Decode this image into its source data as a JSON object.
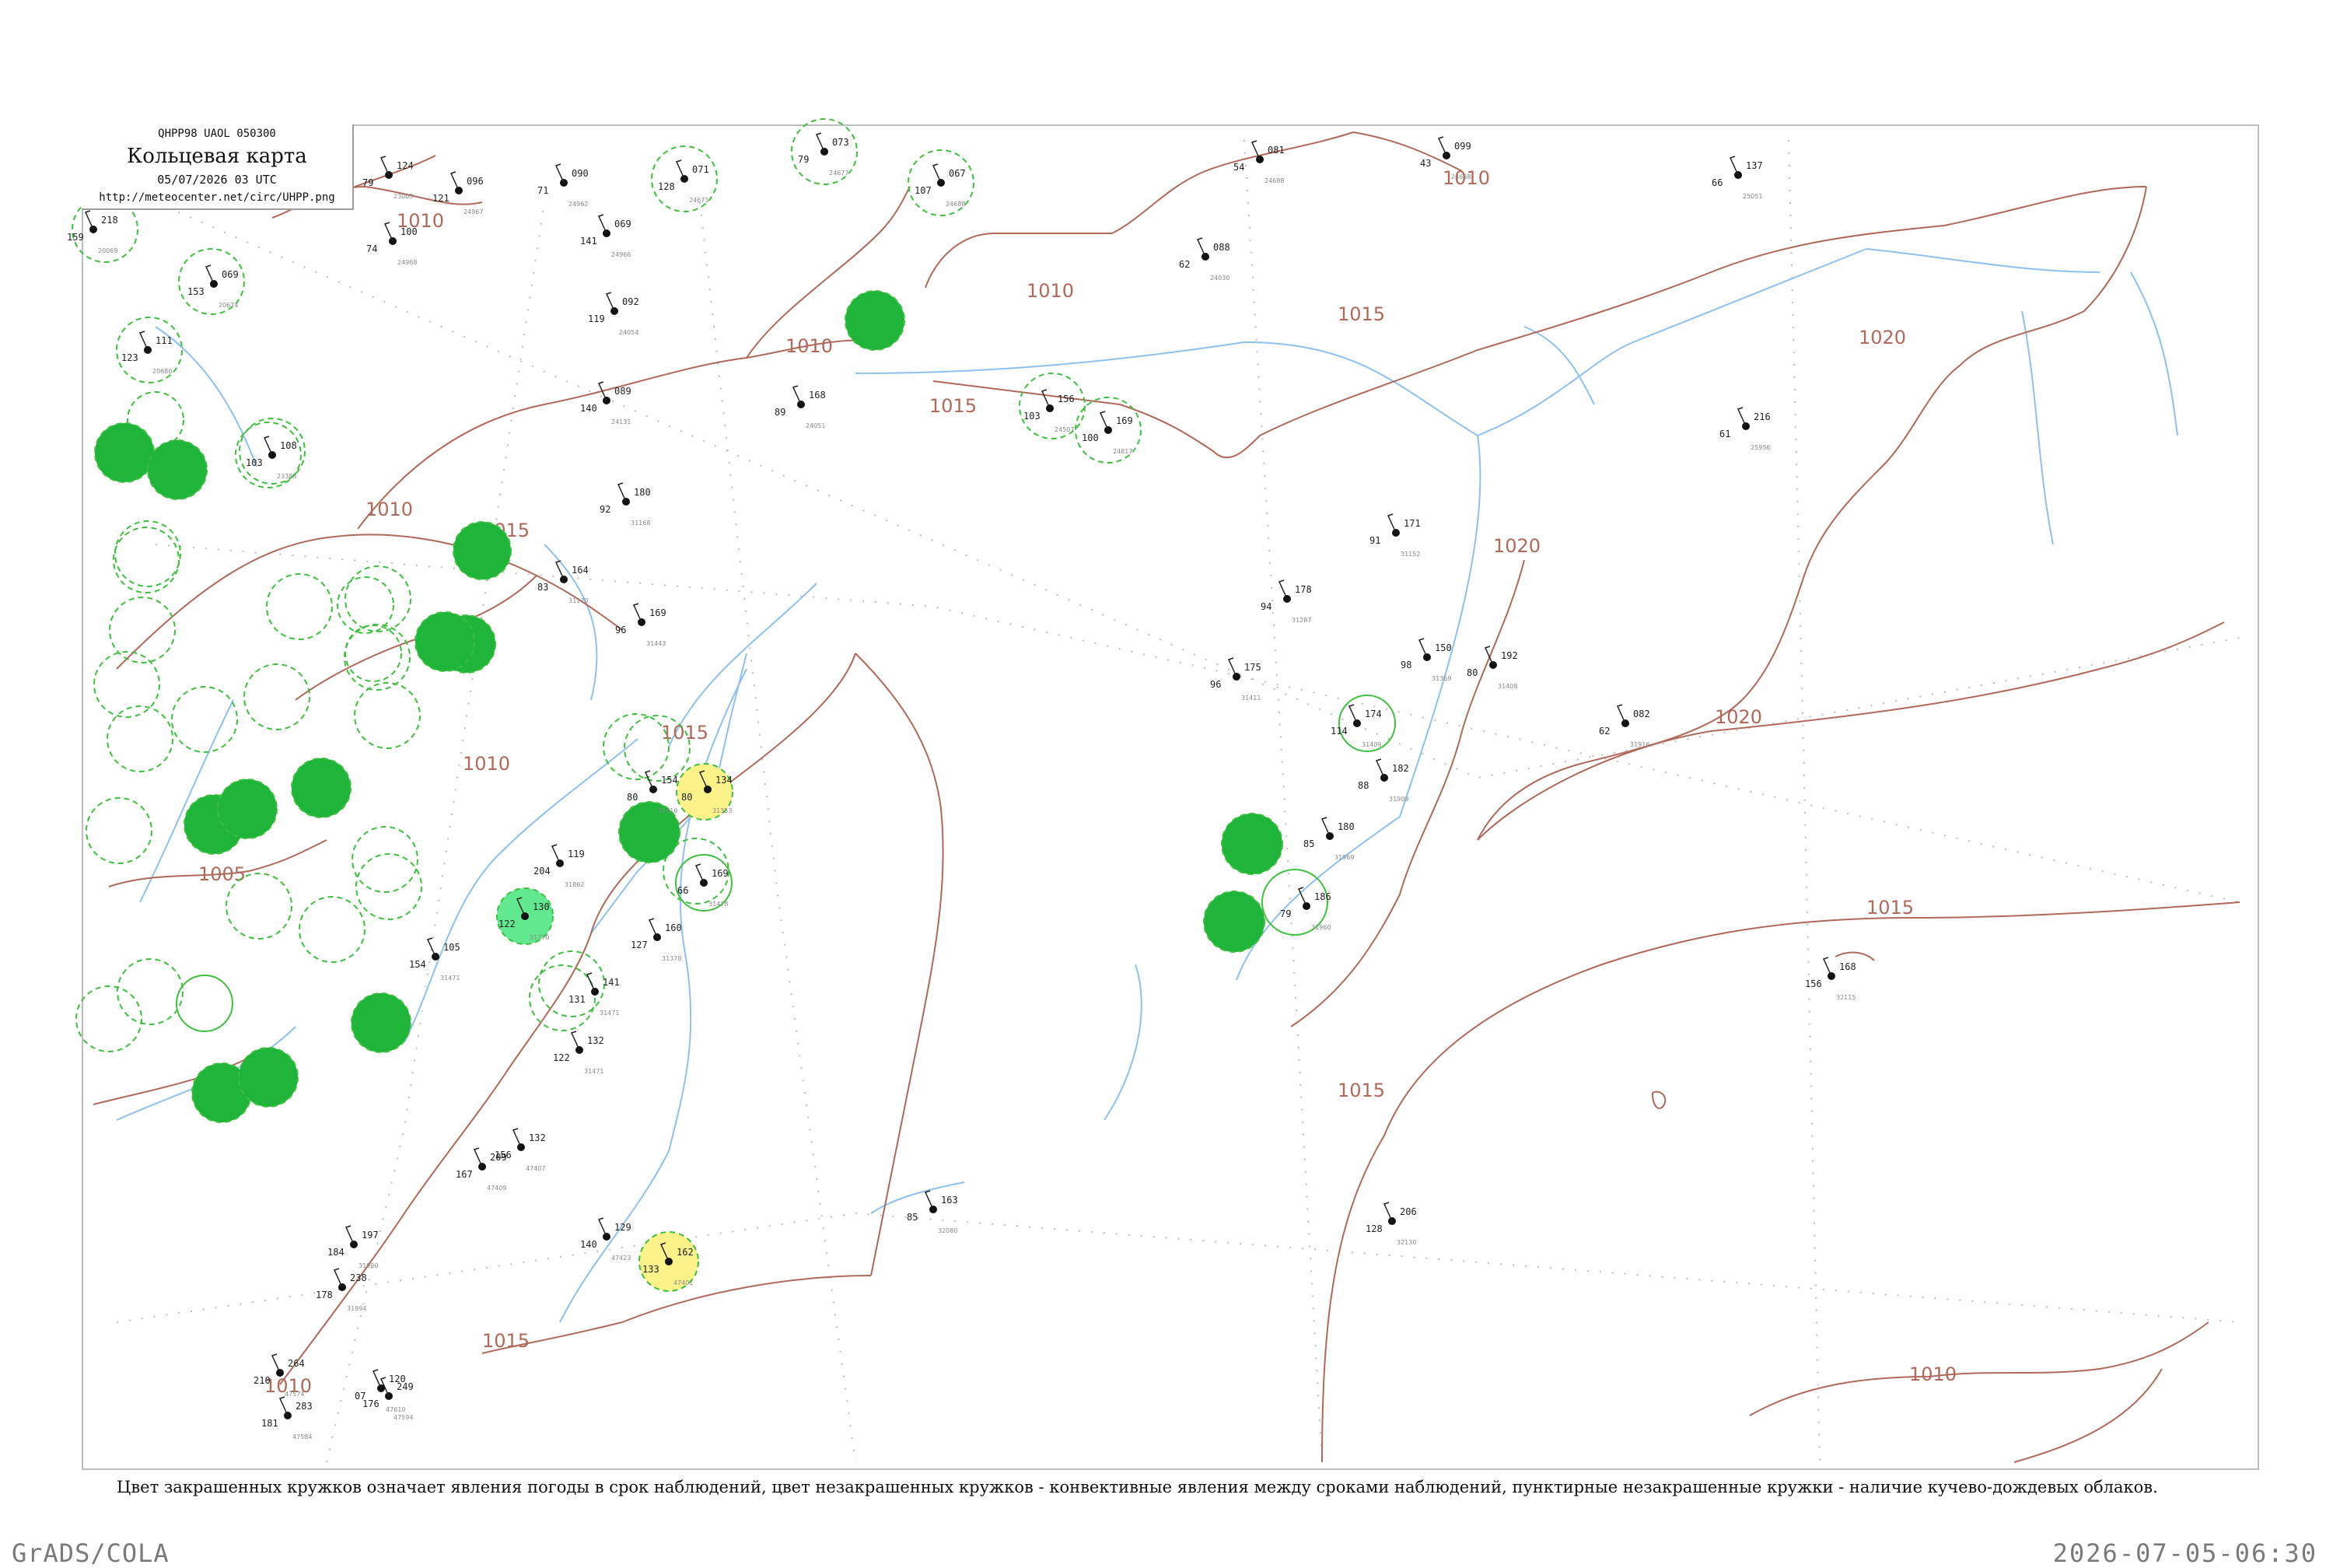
{
  "header": {
    "codes": "QHPP98  UAOL  050300",
    "title": "Кольцевая карта",
    "datetime": "05/07/2026 03 UTC",
    "url": "http://meteocenter.net/circ/UHPP.png"
  },
  "caption": "Цвет закрашенных кружков означает явления погоды в срок наблюдений, цвет незакрашенных кружков - конвективные явления между сроками наблюдений, пунктирные незакрашенные кружки - наличие кучево-дождевых облаков.",
  "footer": {
    "software": "GrADS/COLA",
    "timestamp": "2026-07-05-06:30"
  },
  "colors": {
    "isobar": "#b0695a",
    "water": "#8ec1f0",
    "shower_fill": "#1fb53a",
    "drizzle_fill": "#fbf28a",
    "rain_fill": "#62e88f",
    "cb_circle": "#3fbf3f"
  },
  "isobar_labels": [
    "1010",
    "1010",
    "1010",
    "1010",
    "1010",
    "1010",
    "1010",
    "1015",
    "1015",
    "1015",
    "1015",
    "1015",
    "1015",
    "1015",
    "1020",
    "1020",
    "1020",
    "1005",
    "1010"
  ],
  "stations": [
    {
      "p": "218",
      "t": "159",
      "i": "20069"
    },
    {
      "p": "124",
      "t": "79",
      "i": "23003"
    },
    {
      "p": "096",
      "t": "121",
      "i": "24967"
    },
    {
      "p": "090",
      "t": "71",
      "i": "24962"
    },
    {
      "p": "100",
      "t": "74",
      "i": "24968"
    },
    {
      "p": "069",
      "t": "141",
      "i": "24966"
    },
    {
      "p": "071",
      "t": "128",
      "i": "24671"
    },
    {
      "p": "073",
      "t": "79",
      "i": "24677"
    },
    {
      "p": "067",
      "t": "107",
      "i": "24688"
    },
    {
      "p": "081",
      "t": "54",
      "i": "24688"
    },
    {
      "p": "099",
      "t": "43",
      "i": "24688"
    },
    {
      "p": "137",
      "t": "66",
      "i": "25051"
    },
    {
      "p": "069",
      "t": "153",
      "i": "20674"
    },
    {
      "p": "092",
      "t": "119",
      "i": "24054"
    },
    {
      "p": "088",
      "t": "62",
      "i": "24030"
    },
    {
      "p": "111",
      "t": "123",
      "i": "20680"
    },
    {
      "p": "089",
      "t": "140",
      "i": "24131"
    },
    {
      "p": "168",
      "t": "89",
      "i": "24051"
    },
    {
      "p": "156",
      "t": "103",
      "i": "24507"
    },
    {
      "p": "169",
      "t": "100",
      "i": "24817"
    },
    {
      "p": "216",
      "t": "61",
      "i": "25956"
    },
    {
      "p": "108",
      "t": "103",
      "i": "23383"
    },
    {
      "p": "180",
      "t": "92",
      "i": "31168"
    },
    {
      "p": "164",
      "t": "83",
      "i": "31170"
    },
    {
      "p": "171",
      "t": "91",
      "i": "31152"
    },
    {
      "p": "178",
      "t": "94",
      "i": "31287"
    },
    {
      "p": "169",
      "t": "96",
      "i": "31443"
    },
    {
      "p": "175",
      "t": "96",
      "i": "31411"
    },
    {
      "p": "150",
      "t": "98",
      "i": "31369"
    },
    {
      "p": "192",
      "t": "80",
      "i": "31408"
    },
    {
      "p": "082",
      "t": "62",
      "i": "31916"
    },
    {
      "p": "174",
      "t": "114",
      "i": "31409"
    },
    {
      "p": "182",
      "t": "88",
      "i": "31909"
    },
    {
      "p": "180",
      "t": "85",
      "i": "31969"
    },
    {
      "p": "186",
      "t": "79",
      "i": "31960"
    },
    {
      "p": "168",
      "t": "156",
      "i": "32115"
    },
    {
      "p": "154",
      "t": "80",
      "i": "31416"
    },
    {
      "p": "134",
      "t": "80",
      "i": "31353"
    },
    {
      "p": "169",
      "t": "66",
      "i": "31478"
    },
    {
      "p": "160",
      "t": "127",
      "i": "31378"
    },
    {
      "p": "141",
      "t": "131",
      "i": "31471"
    },
    {
      "p": "132",
      "t": "122",
      "i": "31471"
    },
    {
      "p": "105",
      "t": "154",
      "i": "31471"
    },
    {
      "p": "130",
      "t": "122",
      "i": "31770"
    },
    {
      "p": "119",
      "t": "204",
      "i": "31862"
    },
    {
      "p": "206",
      "t": "128",
      "i": "32130"
    },
    {
      "p": "163",
      "t": "85",
      "i": "32080"
    },
    {
      "p": "162",
      "t": "133",
      "i": "47401"
    },
    {
      "p": "129",
      "t": "140",
      "i": "47423"
    },
    {
      "p": "132",
      "t": "156",
      "i": "47407"
    },
    {
      "p": "209",
      "t": "167",
      "i": "47409"
    },
    {
      "p": "264",
      "t": "210",
      "i": "47574"
    },
    {
      "p": "283",
      "t": "181",
      "i": "47584"
    },
    {
      "p": "249",
      "t": "176",
      "i": "47594"
    },
    {
      "p": "120",
      "t": "07",
      "i": "47610"
    },
    {
      "p": "197",
      "t": "184",
      "i": "31990"
    },
    {
      "p": "238",
      "t": "178",
      "i": "31994"
    }
  ],
  "shaded_circles": 22,
  "cb_circles": 50
}
